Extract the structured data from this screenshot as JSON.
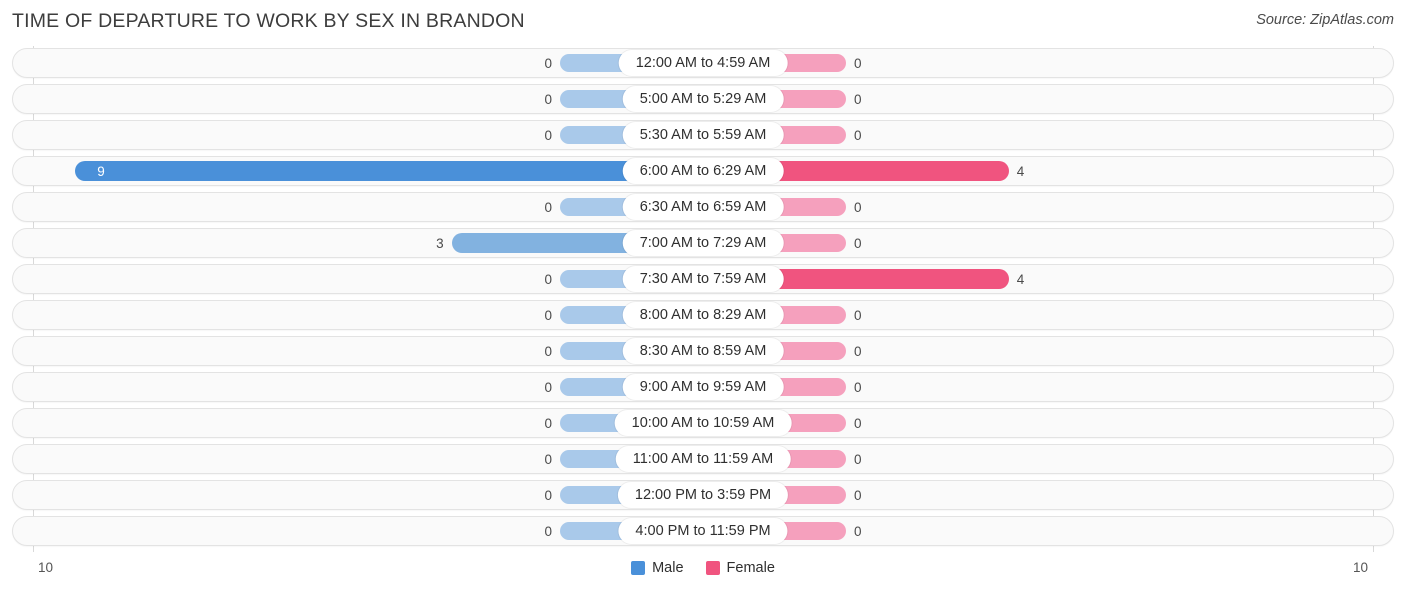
{
  "header": {
    "title": "TIME OF DEPARTURE TO WORK BY SEX IN BRANDON",
    "source": "Source: ZipAtlas.com"
  },
  "axis": {
    "left_tick": "10",
    "right_tick": "10",
    "max": 10
  },
  "legend": {
    "male_label": "Male",
    "female_label": "Female"
  },
  "colors": {
    "male": "#4a90d9",
    "male_light": "#82b2e0",
    "male_pale": "#a9c9ea",
    "female": "#f0547f",
    "female_pale": "#f5a0bd",
    "track": "#fafafa",
    "track_border": "#e3e3e3",
    "axis": "#d9d9d9",
    "text": "#4a4a4a"
  },
  "chart_data": {
    "type": "bar",
    "title": "TIME OF DEPARTURE TO WORK BY SEX IN BRANDON",
    "subtitle": "",
    "orientation": "horizontal",
    "style": "diverging-bidirectional",
    "xlabel": "",
    "ylabel": "",
    "xlim": [
      10,
      10
    ],
    "grid": false,
    "legend_position": "bottom-center",
    "categories": [
      "12:00 AM to 4:59 AM",
      "5:00 AM to 5:29 AM",
      "5:30 AM to 5:59 AM",
      "6:00 AM to 6:29 AM",
      "6:30 AM to 6:59 AM",
      "7:00 AM to 7:29 AM",
      "7:30 AM to 7:59 AM",
      "8:00 AM to 8:29 AM",
      "8:30 AM to 8:59 AM",
      "9:00 AM to 9:59 AM",
      "10:00 AM to 10:59 AM",
      "11:00 AM to 11:59 AM",
      "12:00 PM to 3:59 PM",
      "4:00 PM to 11:59 PM"
    ],
    "series": [
      {
        "name": "Male",
        "values": [
          0,
          0,
          0,
          9,
          0,
          3,
          0,
          0,
          0,
          0,
          0,
          0,
          0,
          0
        ]
      },
      {
        "name": "Female",
        "values": [
          0,
          0,
          0,
          4,
          0,
          0,
          4,
          0,
          0,
          0,
          0,
          0,
          0,
          0
        ]
      }
    ]
  },
  "rows": [
    {
      "category": "12:00 AM to 4:59 AM",
      "male": "0",
      "female": "0"
    },
    {
      "category": "5:00 AM to 5:29 AM",
      "male": "0",
      "female": "0"
    },
    {
      "category": "5:30 AM to 5:59 AM",
      "male": "0",
      "female": "0"
    },
    {
      "category": "6:00 AM to 6:29 AM",
      "male": "9",
      "female": "4"
    },
    {
      "category": "6:30 AM to 6:59 AM",
      "male": "0",
      "female": "0"
    },
    {
      "category": "7:00 AM to 7:29 AM",
      "male": "3",
      "female": "0"
    },
    {
      "category": "7:30 AM to 7:59 AM",
      "male": "0",
      "female": "4"
    },
    {
      "category": "8:00 AM to 8:29 AM",
      "male": "0",
      "female": "0"
    },
    {
      "category": "8:30 AM to 8:59 AM",
      "male": "0",
      "female": "0"
    },
    {
      "category": "9:00 AM to 9:59 AM",
      "male": "0",
      "female": "0"
    },
    {
      "category": "10:00 AM to 10:59 AM",
      "male": "0",
      "female": "0"
    },
    {
      "category": "11:00 AM to 11:59 AM",
      "male": "0",
      "female": "0"
    },
    {
      "category": "12:00 PM to 3:59 PM",
      "male": "0",
      "female": "0"
    },
    {
      "category": "4:00 PM to 11:59 PM",
      "male": "0",
      "female": "0"
    }
  ]
}
